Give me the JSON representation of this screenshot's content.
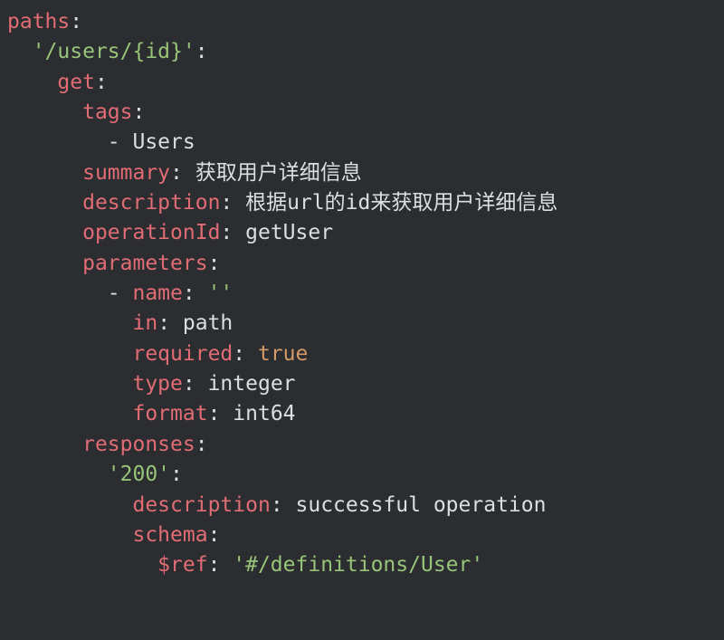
{
  "yaml": {
    "paths": "paths",
    "path_string": "'/users/{id}'",
    "get": "get",
    "tags": "tags",
    "tags_item": "Users",
    "summary": "summary",
    "summary_value": "获取用户详细信息",
    "description": "description",
    "description_value": "根据url的id来获取用户详细信息",
    "operationId": "operationId",
    "operationId_value": "getUser",
    "parameters": "parameters",
    "param_name": "name",
    "param_name_value": "''",
    "param_in": "in",
    "param_in_value": "path",
    "param_required": "required",
    "param_required_value": "true",
    "param_type": "type",
    "param_type_value": "integer",
    "param_format": "format",
    "param_format_value": "int64",
    "responses": "responses",
    "resp_200": "'200'",
    "resp_description": "description",
    "resp_description_value": "successful operation",
    "schema": "schema",
    "ref": "$ref",
    "ref_value": "'#/definitions/User'"
  }
}
